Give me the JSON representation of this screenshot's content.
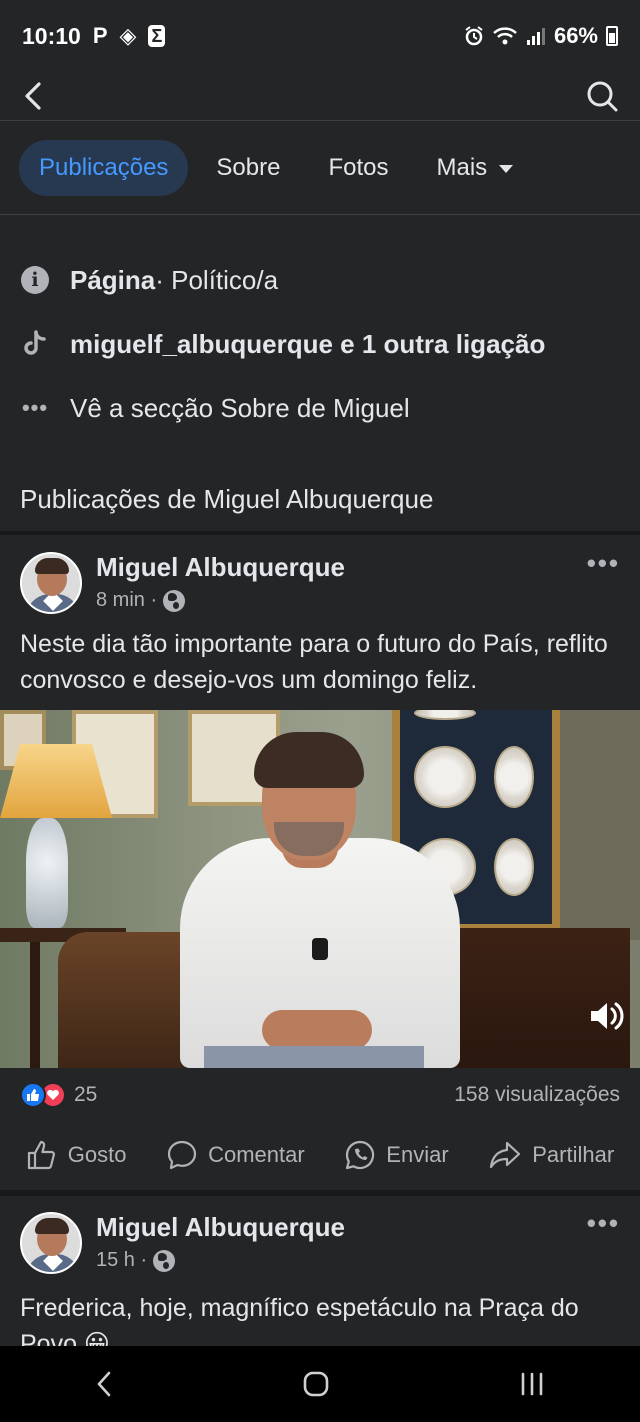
{
  "status_bar": {
    "time": "10:10",
    "notif_icons": [
      "P",
      "◈",
      "Σ"
    ],
    "battery": "66%"
  },
  "tabs": [
    {
      "label": "Publicações",
      "active": true
    },
    {
      "label": "Sobre",
      "active": false
    },
    {
      "label": "Fotos",
      "active": false
    },
    {
      "label": "Mais",
      "active": false
    }
  ],
  "info": {
    "page_label": "Página",
    "page_category": " · Político/a",
    "links_text": "miguelf_albuquerque e 1 outra ligação",
    "about_text": "Vê a secção Sobre de Miguel"
  },
  "section_title": "Publicações de Miguel Albuquerque",
  "posts": [
    {
      "author": "Miguel Albuquerque",
      "time": "8 min ·",
      "text": "Neste dia tão importante para o futuro do País, reflito convosco e desejo-vos um domingo feliz.",
      "reactions_count": "25",
      "views": "158 visualizações"
    },
    {
      "author": "Miguel Albuquerque",
      "time": "15 h ·",
      "text": "Frederica, hoje, magnífico espetáculo na Praça do Povo 😀"
    }
  ],
  "actions": {
    "like": "Gosto",
    "comment": "Comentar",
    "send": "Enviar",
    "share": "Partilhar"
  },
  "colors": {
    "background": "#242526",
    "accent": "#4599ff",
    "tab_active_bg": "#263951",
    "like_blue": "#1877f2",
    "love_red": "#f33e58"
  }
}
